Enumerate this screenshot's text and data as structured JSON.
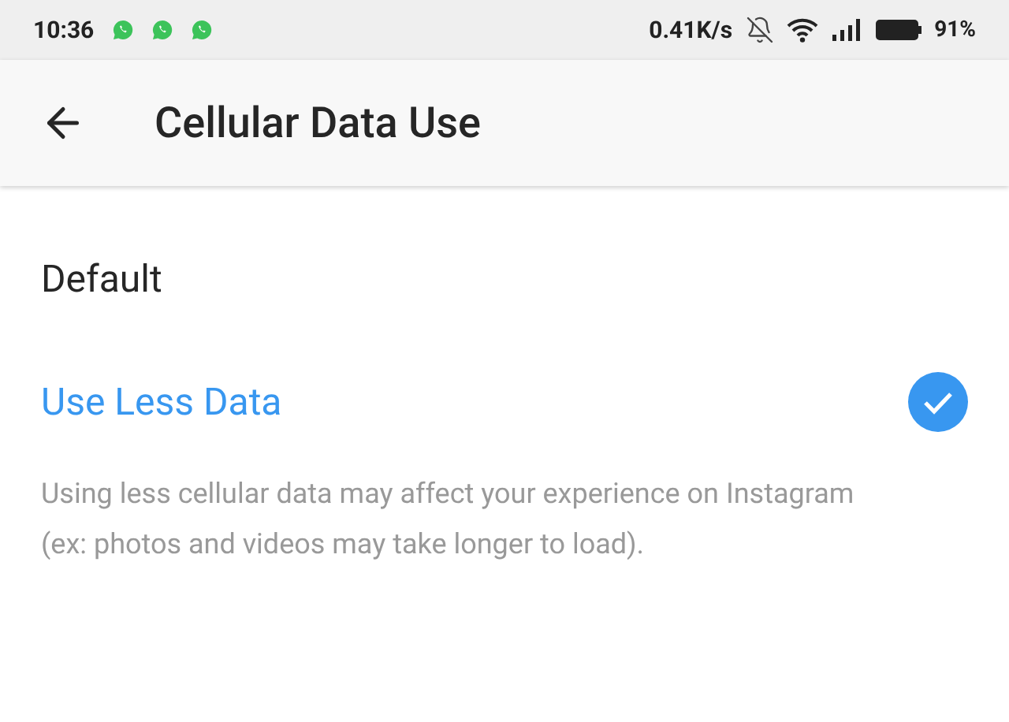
{
  "status_bar": {
    "time": "10:36",
    "notifications": [
      {
        "kind": "chat"
      },
      {
        "kind": "chat"
      },
      {
        "kind": "chat"
      }
    ],
    "speed": "0.41K/s",
    "battery": "91%"
  },
  "header": {
    "title": "Cellular Data Use"
  },
  "options": [
    {
      "label": "Default",
      "selected": false
    },
    {
      "label": "Use Less Data",
      "selected": true
    }
  ],
  "description": "Using less cellular data may affect your experience on Instagram (ex: photos and videos may take longer to load)."
}
